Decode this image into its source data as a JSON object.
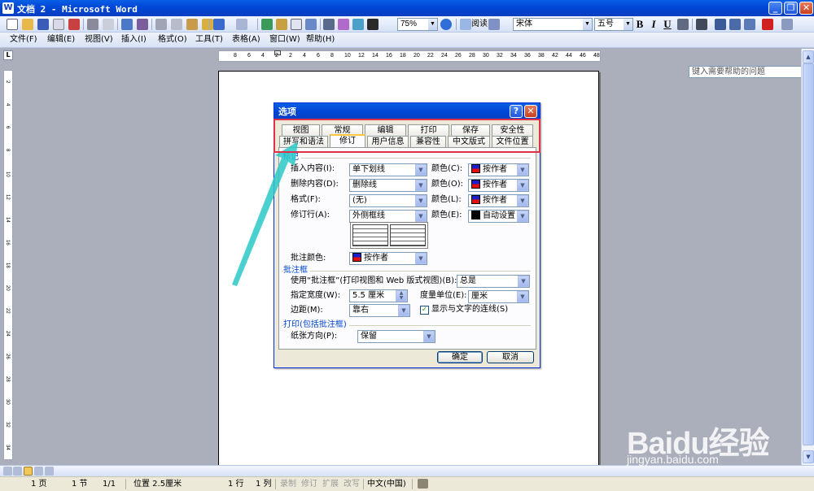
{
  "window": {
    "title": "文档 2 - Microsoft Word"
  },
  "toolbar": {
    "zoom": "75%",
    "read_label": "阅读",
    "font_name": "宋体",
    "font_size": "五号",
    "bold": "B",
    "italic": "I",
    "underline": "U"
  },
  "menu": {
    "items": [
      "文件(F)",
      "编辑(E)",
      "视图(V)",
      "插入(I)",
      "格式(O)",
      "工具(T)",
      "表格(A)",
      "窗口(W)",
      "帮助(H)"
    ],
    "help_placeholder": "键入需要帮助的问题"
  },
  "ruler": {
    "h_ticks": [
      "8",
      "6",
      "4",
      "2",
      "2",
      "4",
      "6",
      "8",
      "10",
      "12",
      "14",
      "16",
      "18",
      "20",
      "22",
      "24",
      "26",
      "28",
      "30",
      "32",
      "34",
      "36",
      "38",
      "42",
      "44",
      "46",
      "48"
    ],
    "v_ticks": [
      "2",
      "4",
      "6",
      "8",
      "10",
      "12",
      "14",
      "16",
      "18",
      "20",
      "22",
      "24",
      "26",
      "28",
      "30",
      "32",
      "34"
    ]
  },
  "dialog": {
    "title": "选项",
    "tabs_row1": [
      "视图",
      "常规",
      "编辑",
      "打印",
      "保存",
      "安全性"
    ],
    "tabs_row2": [
      "拼写和语法",
      "修订",
      "用户信息",
      "兼容性",
      "中文版式",
      "文件位置"
    ],
    "group_mark": "标记",
    "insert_label": "插入内容(I):",
    "insert_value": "单下划线",
    "delete_label": "删除内容(D):",
    "delete_value": "删除线",
    "format_label": "格式(F):",
    "format_value": "(无)",
    "changedline_label": "修订行(A):",
    "changedline_value": "外侧框线",
    "color_c_label": "颜色(C):",
    "color_o_label": "颜色(O):",
    "color_l_label": "颜色(L):",
    "color_e_label": "颜色(E):",
    "color_by_author": "按作者",
    "color_auto": "自动设置",
    "comment_color_label": "批注颜色:",
    "comment_color_value": "按作者",
    "group_balloons": "批注框",
    "use_balloons_label": "使用“批注框”(打印视图和 Web 版式视图)(B):",
    "use_balloons_value": "总是",
    "width_label": "指定宽度(W):",
    "width_value": "5.5 厘米",
    "unit_label": "度量单位(E):",
    "unit_value": "厘米",
    "margin_label": "边距(M):",
    "margin_value": "靠右",
    "show_lines_label": "显示与文字的连线(S)",
    "group_print": "打印(包括批注框)",
    "orientation_label": "纸张方向(P):",
    "orientation_value": "保留",
    "ok": "确定",
    "cancel": "取消"
  },
  "status": {
    "page": "1 页",
    "section": "1 节",
    "pages": "1/1",
    "position": "位置 2.5厘米",
    "line": "1 行",
    "col": "1 列",
    "rec": "录制",
    "trk": "修订",
    "ext": "扩展",
    "ovr": "改写",
    "lang": "中文(中国)"
  },
  "watermark": {
    "text": "Baidu经验",
    "sub": "jingyan.baidu.com"
  },
  "colors": {
    "accent": "#0A5FE6",
    "highlight": "#E0304A",
    "arrow": "#2CC8C8"
  }
}
